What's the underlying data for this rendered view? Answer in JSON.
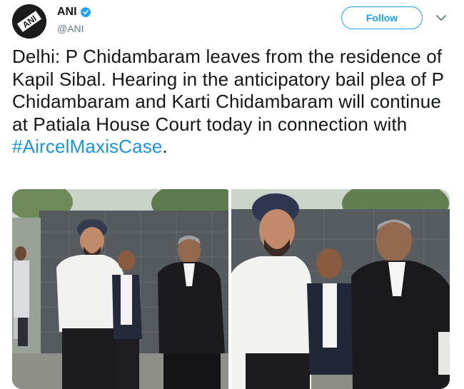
{
  "account": {
    "display_name": "ANI",
    "handle": "@ANI",
    "avatar_text": "ANI",
    "verified": true
  },
  "follow_button": {
    "label": "Follow"
  },
  "menu": {
    "icon": "chevron-down-icon"
  },
  "tweet": {
    "text": "Delhi: P Chidambaram leaves from the residence of Kapil Sibal. Hearing in the anticipatory bail plea of P Chidambaram and Karti Chidambaram will continue at Patiala House Court today in connection with ",
    "hashtag": "#AircelMaxisCase",
    "text_end": "."
  },
  "media": {
    "photo_count": 2,
    "photos": [
      "photo-left",
      "photo-right"
    ]
  },
  "colors": {
    "accent": "#1da1f2",
    "hashtag": "#1b95e0",
    "text": "#14171a",
    "secondary": "#657786"
  }
}
